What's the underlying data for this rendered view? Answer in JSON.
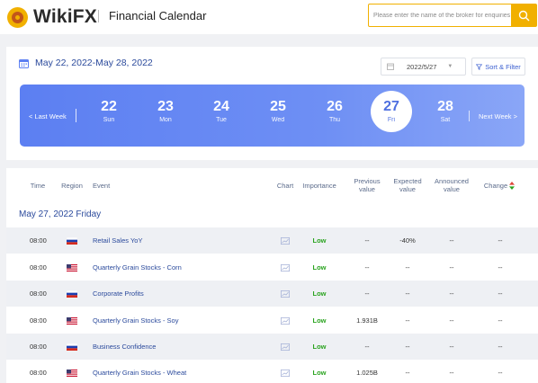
{
  "header": {
    "logo_main": "WikiFX",
    "section_title": "Financial Calendar",
    "search_placeholder": "Please enter the name of the broker for enquiries"
  },
  "calendar": {
    "date_range": "May 22, 2022-May 28, 2022",
    "date_picker_value": "2022/5/27",
    "sort_filter_label": "Sort & Filter",
    "prev_label": "Last Week",
    "next_label": "Next Week",
    "days": [
      {
        "num": "22",
        "name": "Sun",
        "active": false
      },
      {
        "num": "23",
        "name": "Mon",
        "active": false
      },
      {
        "num": "24",
        "name": "Tue",
        "active": false
      },
      {
        "num": "25",
        "name": "Wed",
        "active": false
      },
      {
        "num": "26",
        "name": "Thu",
        "active": false
      },
      {
        "num": "27",
        "name": "Fri",
        "active": true
      },
      {
        "num": "28",
        "name": "Sat",
        "active": false
      }
    ]
  },
  "events_table": {
    "headers": {
      "time": "Time",
      "region": "Region",
      "event": "Event",
      "chart": "Chart",
      "importance": "Importance",
      "previous_1": "Previous",
      "previous_2": "value",
      "expected_1": "Expected",
      "expected_2": "value",
      "announced_1": "Announced",
      "announced_2": "value",
      "change": "Change"
    },
    "day_heading": "May 27, 2022 Friday",
    "rows": [
      {
        "time": "08:00",
        "region": "russia-flag",
        "event": "Retail Sales YoY",
        "importance": "Low",
        "previous": "--",
        "expected": "-40%",
        "announced": "--",
        "change": "--"
      },
      {
        "time": "08:00",
        "region": "us-flag",
        "event": "Quarterly Grain Stocks - Corn",
        "importance": "Low",
        "previous": "--",
        "expected": "--",
        "announced": "--",
        "change": "--"
      },
      {
        "time": "08:00",
        "region": "russia-flag",
        "event": "Corporate Profits",
        "importance": "Low",
        "previous": "--",
        "expected": "--",
        "announced": "--",
        "change": "--"
      },
      {
        "time": "08:00",
        "region": "us-flag",
        "event": "Quarterly Grain Stocks - Soy",
        "importance": "Low",
        "previous": "1.931B",
        "expected": "--",
        "announced": "--",
        "change": "--"
      },
      {
        "time": "08:00",
        "region": "russia-flag",
        "event": "Business Confidence",
        "importance": "Low",
        "previous": "--",
        "expected": "--",
        "announced": "--",
        "change": "--"
      },
      {
        "time": "08:00",
        "region": "us-flag",
        "event": "Quarterly Grain Stocks - Wheat",
        "importance": "Low",
        "previous": "1.025B",
        "expected": "--",
        "announced": "--",
        "change": "--"
      }
    ]
  },
  "colors": {
    "brand_orange": "#f1b000",
    "brand_red": "#c2561a",
    "link_blue": "#2b4a9c",
    "importance_low": "#2aa31f",
    "strip_start": "#5c7ff2",
    "strip_end": "#8aa6f7"
  }
}
